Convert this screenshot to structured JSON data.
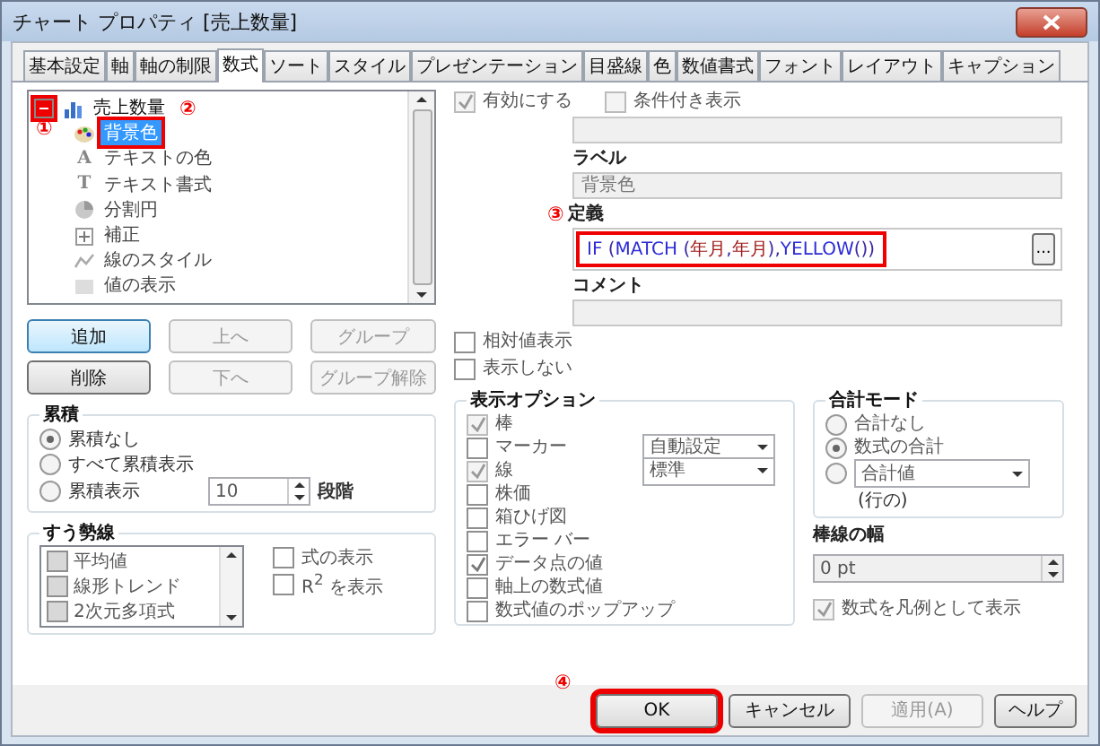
{
  "window": {
    "title": "チャート プロパティ [売上数量]"
  },
  "tabs": [
    {
      "label": "基本設定",
      "selected": false
    },
    {
      "label": "軸",
      "selected": false
    },
    {
      "label": "軸の制限",
      "selected": false
    },
    {
      "label": "数式",
      "selected": true
    },
    {
      "label": "ソート",
      "selected": false
    },
    {
      "label": "スタイル",
      "selected": false
    },
    {
      "label": "プレゼンテーション",
      "selected": false
    },
    {
      "label": "目盛線",
      "selected": false
    },
    {
      "label": "色",
      "selected": false
    },
    {
      "label": "数値書式",
      "selected": false
    },
    {
      "label": "フォント",
      "selected": false
    },
    {
      "label": "レイアウト",
      "selected": false
    },
    {
      "label": "キャプション",
      "selected": false
    }
  ],
  "tree": {
    "label": "売上数量",
    "expanded": true,
    "highlighted": true,
    "children": [
      {
        "label": "背景色",
        "kind": "palette",
        "selected": true,
        "highlighted": true
      },
      {
        "label": "テキストの色",
        "kind": "glyph",
        "glyph": "A",
        "selected": false,
        "highlighted": false
      },
      {
        "label": "テキスト書式",
        "kind": "glyph",
        "glyph": "T",
        "selected": false,
        "highlighted": false
      },
      {
        "label": "分割円",
        "kind": "pie",
        "selected": false,
        "highlighted": false
      },
      {
        "label": "補正",
        "kind": "plus",
        "selected": false,
        "highlighted": false
      },
      {
        "label": "線のスタイル",
        "kind": "line",
        "selected": false,
        "highlighted": false
      },
      {
        "label": "値の表示",
        "kind": "number",
        "selected": false,
        "highlighted": false
      }
    ]
  },
  "list_buttons": [
    {
      "label": "追加",
      "disabled": false,
      "default": true
    },
    {
      "label": "上へ",
      "disabled": true,
      "default": false
    },
    {
      "label": "グループ",
      "disabled": true,
      "default": false
    },
    {
      "label": "削除",
      "disabled": false,
      "default": false
    },
    {
      "label": "下へ",
      "disabled": true,
      "default": false
    },
    {
      "label": "グループ解除",
      "disabled": true,
      "default": false
    }
  ],
  "accumulation": {
    "title": "累積",
    "options": [
      {
        "label": "累積なし",
        "selected": true
      },
      {
        "label": "すべて累積表示",
        "selected": false
      },
      {
        "label": "累積表示",
        "selected": false
      }
    ],
    "steps": "10",
    "steps_label": "段階"
  },
  "trendlines": {
    "title": "すう勢線",
    "items": [
      {
        "label": "平均値",
        "checked": false
      },
      {
        "label": "線形トレンド",
        "checked": false
      },
      {
        "label": "2次元多項式",
        "checked": false
      }
    ],
    "checks": [
      {
        "label": "式の表示",
        "checked": false
      },
      {
        "label": "R$^{2}$ を表示",
        "checked": false
      }
    ]
  },
  "enable": {
    "label": "有効にする",
    "checked": true,
    "disabled": true
  },
  "conditional": {
    "label": "条件付き表示",
    "checked": false,
    "disabled": true
  },
  "label_field": {
    "label": "ラベル",
    "value": "背景色"
  },
  "definition": {
    "label": "定義",
    "highlighted": true,
    "button": "...",
    "tokens": [
      {
        "text": "IF ",
        "kind": "function"
      },
      {
        "text": "(",
        "kind": "punct"
      },
      {
        "text": "MATCH ",
        "kind": "function"
      },
      {
        "text": "(",
        "kind": "punct"
      },
      {
        "text": "年月",
        "kind": "field"
      },
      {
        "text": ",",
        "kind": "punct"
      },
      {
        "text": "年月",
        "kind": "field"
      },
      {
        "text": "),",
        "kind": "punct"
      },
      {
        "text": "YELLOW",
        "kind": "function"
      },
      {
        "text": "())",
        "kind": "punct"
      }
    ]
  },
  "comment": {
    "label": "コメント"
  },
  "relative": {
    "label": "相対値表示",
    "checked": false
  },
  "hide": {
    "label": "表示しない",
    "checked": false
  },
  "display_options": {
    "title": "表示オプション",
    "items": [
      {
        "label": "棒",
        "checked": true,
        "disabled": true
      },
      {
        "label": "マーカー",
        "checked": false,
        "disabled": false,
        "dropdown": "自動設定"
      },
      {
        "label": "線",
        "checked": true,
        "disabled": true,
        "dropdown": "標準"
      },
      {
        "label": "株価",
        "checked": false,
        "disabled": false
      },
      {
        "label": "箱ひげ図",
        "checked": false,
        "disabled": false
      },
      {
        "label": "エラー バー",
        "checked": false,
        "disabled": false
      },
      {
        "label": "データ点の値",
        "checked": true,
        "disabled": false
      },
      {
        "label": "軸上の数式値",
        "checked": false,
        "disabled": false
      },
      {
        "label": "数式値のポップアップ",
        "checked": false,
        "disabled": false
      }
    ]
  },
  "total_mode": {
    "title": "合計モード",
    "options": [
      {
        "kind": "label",
        "label": "合計なし",
        "selected": false
      },
      {
        "kind": "label",
        "label": "数式の合計",
        "selected": true
      },
      {
        "kind": "dropdown",
        "value": "合計値",
        "selected": false
      }
    ],
    "note": "(行の)"
  },
  "bar_width": {
    "label": "棒線の幅",
    "value": "0 pt"
  },
  "legend": {
    "label": "数式を凡例として表示",
    "checked": true,
    "disabled": true
  },
  "buttons": [
    {
      "label": "OK",
      "highlighted": true,
      "disabled": false
    },
    {
      "label": "キャンセル",
      "highlighted": false,
      "disabled": false
    },
    {
      "label": "適用(A)",
      "highlighted": false,
      "disabled": true
    },
    {
      "label": "ヘルプ",
      "highlighted": false,
      "disabled": false
    }
  ],
  "annotations": [
    {
      "kind": "toggle",
      "label": "①"
    },
    {
      "kind": "item",
      "label": "②"
    },
    {
      "kind": "definition",
      "label": "③"
    },
    {
      "kind": "ok",
      "label": "④"
    }
  ]
}
